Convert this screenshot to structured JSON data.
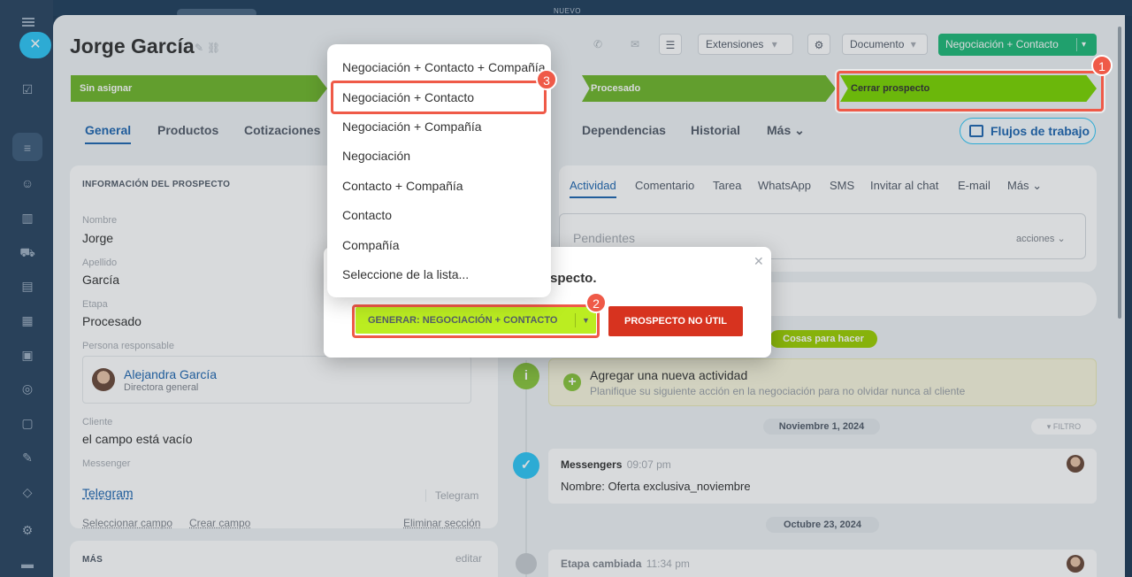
{
  "top_strip": {
    "label": "NUEVO"
  },
  "header": {
    "title": "Jorge García",
    "extensions_label": "Extensiones",
    "documento_label": "Documento",
    "convert_label": "Negociación + Contacto"
  },
  "stages": [
    "Sin asignar",
    "Procesado",
    "Cerrar prospecto"
  ],
  "tabs": [
    "General",
    "Productos",
    "Cotizaciones",
    "Dependencias",
    "Historial",
    "Más"
  ],
  "flujos_label": "Flujos de trabajo",
  "info": {
    "section_title": "INFORMACIÓN DEL PROSPECTO",
    "fields": [
      {
        "label": "Nombre",
        "value": "Jorge"
      },
      {
        "label": "Apellido",
        "value": "García"
      },
      {
        "label": "Etapa",
        "value": "Procesado"
      }
    ],
    "responsible_label": "Persona responsable",
    "responsible_name": "Alejandra García",
    "responsible_role": "Directora general",
    "client_label": "Cliente",
    "client_value": "el campo está vacío",
    "messenger_label": "Messenger",
    "messenger_value": "Telegram",
    "messenger_type": "Telegram",
    "select_field": "Seleccionar campo",
    "create_field": "Crear campo",
    "delete_section": "Eliminar sección",
    "more_title": "MÁS",
    "edit": "editar"
  },
  "activity": {
    "tabs": [
      "Actividad",
      "Comentario",
      "Tarea",
      "WhatsApp",
      "SMS",
      "Invitar al chat",
      "E-mail",
      "Más"
    ],
    "pending_placeholder": "Pendientes",
    "actions_label": "acciones",
    "todo_pill": "Cosas para hacer",
    "todo_title": "Agregar una nueva actividad",
    "todo_sub": "Planifique su siguiente acción en la negociación para no olvidar nunca al cliente",
    "date1": "Noviembre 1, 2024",
    "filter": "FILTRO",
    "msg_title": "Messengers",
    "msg_time": "09:07 pm",
    "msg_body": "Nombre: Oferta exclusiva_noviembre",
    "date2": "Octubre 23, 2024",
    "stage_changed": "Etapa cambiada",
    "stage_time": "11:34 pm"
  },
  "popup": {
    "text": "specto.",
    "generate_label": "GENERAR: NEGOCIACIÓN + CONTACTO",
    "not_useful_label": "PROSPECTO NO ÚTIL"
  },
  "dropdown": {
    "items": [
      "Negociación + Contacto + Compañía",
      "Negociación + Contacto",
      "Negociación + Compañía",
      "Negociación",
      "Contacto + Compañía",
      "Contacto",
      "Compañía",
      "Seleccione de la lista..."
    ]
  },
  "badges": [
    "1",
    "2",
    "3"
  ],
  "colors": {
    "accent": "#2067b0",
    "highlight": "#ef5a48",
    "stage_green": "#6fb62b",
    "stage_active": "#7bd500"
  }
}
